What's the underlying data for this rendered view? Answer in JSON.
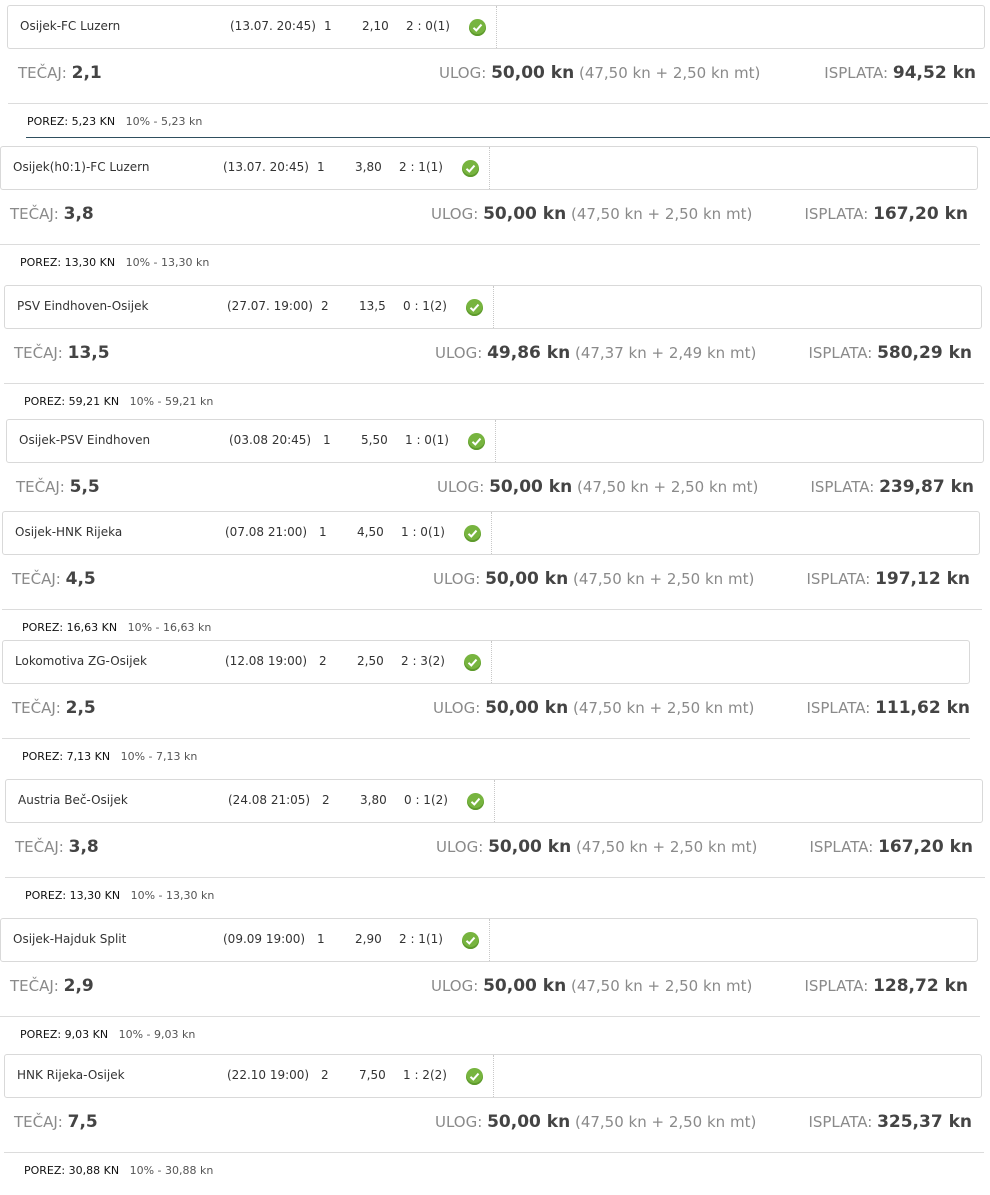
{
  "labels": {
    "tecaj": "TEČAJ:",
    "ulog": "ULOG:",
    "isplata": "ISPLATA:",
    "porez": "POREZ:"
  },
  "tickets": [
    {
      "match": "Osijek-FC Luzern",
      "time": "(13.07. 20:45)",
      "tip": "1",
      "odd": "2,10",
      "result": "2 : 0(1)",
      "tecaj": "2,1",
      "ulog": "50,00 kn",
      "ulog_detail": "(47,50 kn + 2,50 kn mt)",
      "isplata": "94,52 kn",
      "porez": "5,23 KN",
      "porez_detail": "10% - 5,23 kn"
    },
    {
      "match": "Osijek(h0:1)-FC Luzern",
      "time": "(13.07. 20:45)",
      "tip": "1",
      "odd": "3,80",
      "result": "2 : 1(1)",
      "tecaj": "3,8",
      "ulog": "50,00 kn",
      "ulog_detail": "(47,50 kn + 2,50 kn mt)",
      "isplata": "167,20 kn",
      "porez": "13,30 KN",
      "porez_detail": "10% - 13,30 kn"
    },
    {
      "match": "PSV Eindhoven-Osijek",
      "time": "(27.07. 19:00)",
      "tip": "2",
      "odd": "13,5",
      "result": "0 : 1(2)",
      "tecaj": "13,5",
      "ulog": "49,86 kn",
      "ulog_detail": "(47,37 kn + 2,49 kn mt)",
      "isplata": "580,29 kn",
      "porez": "59,21 KN",
      "porez_detail": "10% - 59,21 kn"
    },
    {
      "match": "Osijek-PSV Eindhoven",
      "time": "(03.08 20:45)",
      "tip": "1",
      "odd": "5,50",
      "result": "1 : 0(1)",
      "tecaj": "5,5",
      "ulog": "50,00 kn",
      "ulog_detail": "(47,50 kn + 2,50 kn mt)",
      "isplata": "239,87 kn",
      "porez": "",
      "porez_detail": ""
    },
    {
      "match": "Osijek-HNK Rijeka",
      "time": "(07.08 21:00)",
      "tip": "1",
      "odd": "4,50",
      "result": "1 : 0(1)",
      "tecaj": "4,5",
      "ulog": "50,00 kn",
      "ulog_detail": "(47,50 kn + 2,50 kn mt)",
      "isplata": "197,12 kn",
      "porez": "16,63 KN",
      "porez_detail": "10% - 16,63 kn"
    },
    {
      "match": "Lokomotiva ZG-Osijek",
      "time": "(12.08 19:00)",
      "tip": "2",
      "odd": "2,50",
      "result": "2 : 3(2)",
      "tecaj": "2,5",
      "ulog": "50,00 kn",
      "ulog_detail": "(47,50 kn + 2,50 kn mt)",
      "isplata": "111,62 kn",
      "porez": "7,13 KN",
      "porez_detail": "10% - 7,13 kn"
    },
    {
      "match": "Austria Beč-Osijek",
      "time": "(24.08 21:05)",
      "tip": "2",
      "odd": "3,80",
      "result": "0 : 1(2)",
      "tecaj": "3,8",
      "ulog": "50,00 kn",
      "ulog_detail": "(47,50 kn + 2,50 kn mt)",
      "isplata": "167,20 kn",
      "porez": "13,30 KN",
      "porez_detail": "10% - 13,30 kn"
    },
    {
      "match": "Osijek-Hajduk Split",
      "time": "(09.09 19:00)",
      "tip": "1",
      "odd": "2,90",
      "result": "2 : 1(1)",
      "tecaj": "2,9",
      "ulog": "50,00 kn",
      "ulog_detail": "(47,50 kn + 2,50 kn mt)",
      "isplata": "128,72 kn",
      "porez": "9,03 KN",
      "porez_detail": "10% - 9,03 kn"
    },
    {
      "match": "HNK Rijeka-Osijek",
      "time": "(22.10 19:00)",
      "tip": "2",
      "odd": "7,50",
      "result": "1 : 2(2)",
      "tecaj": "7,5",
      "ulog": "50,00 kn",
      "ulog_detail": "(47,50 kn + 2,50 kn mt)",
      "isplata": "325,37 kn",
      "porez": "30,88 KN",
      "porez_detail": "10% - 30,88 kn"
    }
  ],
  "colors": {
    "check_green": "#77b43f",
    "label_grey": "#8a8a8a",
    "value_dark": "#444444"
  },
  "icons": {
    "status": "check-circle-icon"
  }
}
